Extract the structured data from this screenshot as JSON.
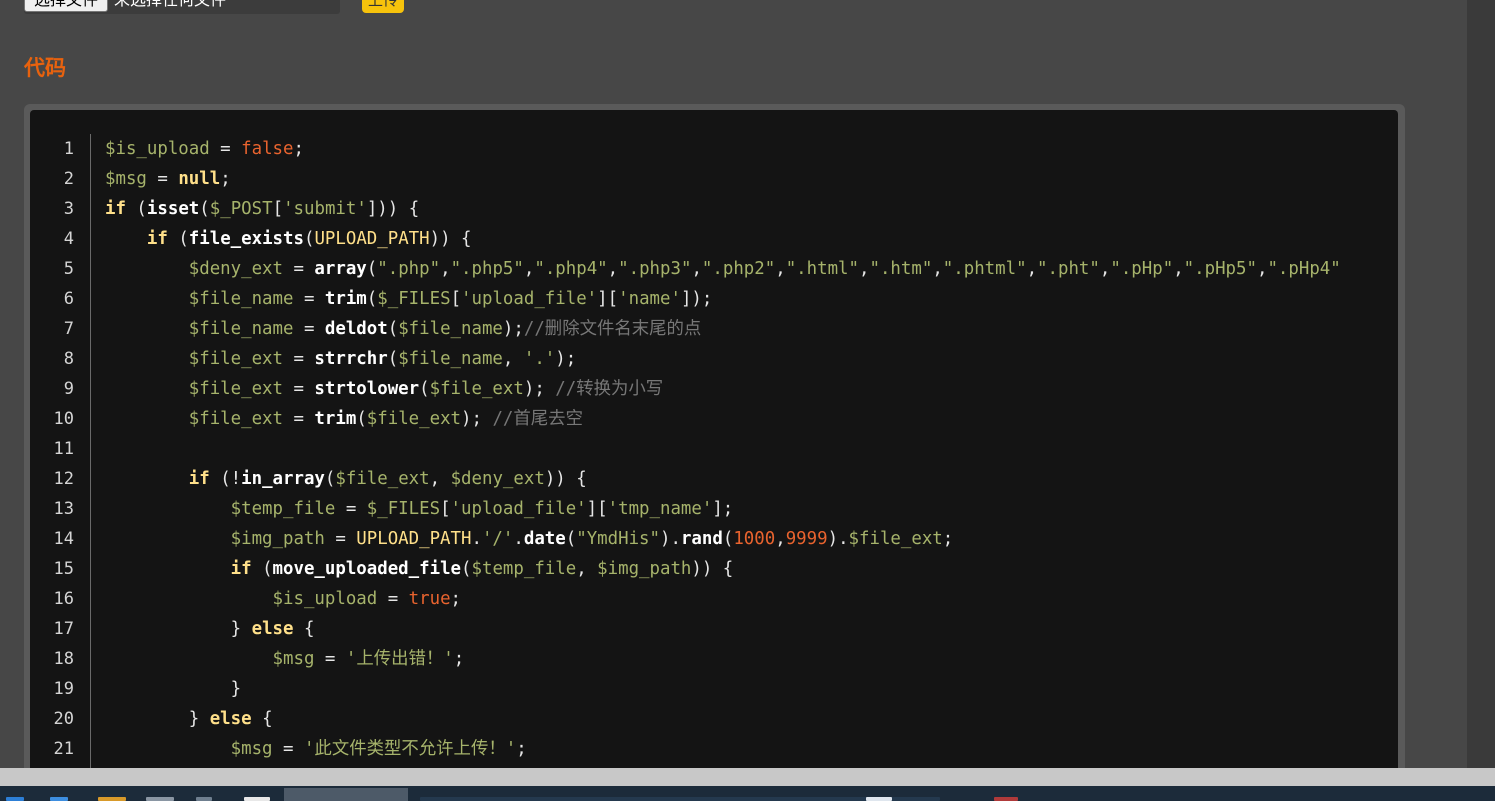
{
  "upload_form": {
    "file_button_label": "选择文件",
    "file_status": "未选择任何文件",
    "upload_button_label": "上传"
  },
  "section": {
    "title": "代码"
  },
  "code": {
    "line_numbers": [
      "1",
      "2",
      "3",
      "4",
      "5",
      "6",
      "7",
      "8",
      "9",
      "10",
      "11",
      "12",
      "13",
      "14",
      "15",
      "16",
      "17",
      "18",
      "19",
      "20",
      "21"
    ],
    "lines": [
      [
        [
          "var",
          "$is_upload"
        ],
        [
          "pn",
          " = "
        ],
        [
          "bool",
          "false"
        ],
        [
          "pn",
          ";"
        ]
      ],
      [
        [
          "var",
          "$msg"
        ],
        [
          "pn",
          " = "
        ],
        [
          "kw",
          "null"
        ],
        [
          "pn",
          ";"
        ]
      ],
      [
        [
          "kw",
          "if"
        ],
        [
          "pn",
          " ("
        ],
        [
          "fn",
          "isset"
        ],
        [
          "pn",
          "("
        ],
        [
          "var",
          "$_POST"
        ],
        [
          "pn",
          "["
        ],
        [
          "str",
          "'submit'"
        ],
        [
          "pn",
          "])) {"
        ]
      ],
      [
        [
          "pn",
          "    "
        ],
        [
          "kw",
          "if"
        ],
        [
          "pn",
          " ("
        ],
        [
          "fn",
          "file_exists"
        ],
        [
          "pn",
          "("
        ],
        [
          "const",
          "UPLOAD_PATH"
        ],
        [
          "pn",
          ")) {"
        ]
      ],
      [
        [
          "pn",
          "        "
        ],
        [
          "var",
          "$deny_ext"
        ],
        [
          "pn",
          " = "
        ],
        [
          "fn",
          "array"
        ],
        [
          "pn",
          "("
        ],
        [
          "str",
          "\".php\""
        ],
        [
          "pn",
          ","
        ],
        [
          "str",
          "\".php5\""
        ],
        [
          "pn",
          ","
        ],
        [
          "str",
          "\".php4\""
        ],
        [
          "pn",
          ","
        ],
        [
          "str",
          "\".php3\""
        ],
        [
          "pn",
          ","
        ],
        [
          "str",
          "\".php2\""
        ],
        [
          "pn",
          ","
        ],
        [
          "str",
          "\".html\""
        ],
        [
          "pn",
          ","
        ],
        [
          "str",
          "\".htm\""
        ],
        [
          "pn",
          ","
        ],
        [
          "str",
          "\".phtml\""
        ],
        [
          "pn",
          ","
        ],
        [
          "str",
          "\".pht\""
        ],
        [
          "pn",
          ","
        ],
        [
          "str",
          "\".pHp\""
        ],
        [
          "pn",
          ","
        ],
        [
          "str",
          "\".pHp5\""
        ],
        [
          "pn",
          ","
        ],
        [
          "str",
          "\".pHp4\""
        ]
      ],
      [
        [
          "pn",
          "        "
        ],
        [
          "var",
          "$file_name"
        ],
        [
          "pn",
          " = "
        ],
        [
          "fn",
          "trim"
        ],
        [
          "pn",
          "("
        ],
        [
          "var",
          "$_FILES"
        ],
        [
          "pn",
          "["
        ],
        [
          "str",
          "'upload_file'"
        ],
        [
          "pn",
          "]["
        ],
        [
          "str",
          "'name'"
        ],
        [
          "pn",
          "]);"
        ]
      ],
      [
        [
          "pn",
          "        "
        ],
        [
          "var",
          "$file_name"
        ],
        [
          "pn",
          " = "
        ],
        [
          "fn",
          "deldot"
        ],
        [
          "pn",
          "("
        ],
        [
          "var",
          "$file_name"
        ],
        [
          "pn",
          ");"
        ],
        [
          "cmt",
          "//删除文件名末尾的点"
        ]
      ],
      [
        [
          "pn",
          "        "
        ],
        [
          "var",
          "$file_ext"
        ],
        [
          "pn",
          " = "
        ],
        [
          "fn",
          "strrchr"
        ],
        [
          "pn",
          "("
        ],
        [
          "var",
          "$file_name"
        ],
        [
          "pn",
          ", "
        ],
        [
          "str",
          "'.'"
        ],
        [
          "pn",
          ");"
        ]
      ],
      [
        [
          "pn",
          "        "
        ],
        [
          "var",
          "$file_ext"
        ],
        [
          "pn",
          " = "
        ],
        [
          "fn",
          "strtolower"
        ],
        [
          "pn",
          "("
        ],
        [
          "var",
          "$file_ext"
        ],
        [
          "pn",
          "); "
        ],
        [
          "cmt",
          "//转换为小写"
        ]
      ],
      [
        [
          "pn",
          "        "
        ],
        [
          "var",
          "$file_ext"
        ],
        [
          "pn",
          " = "
        ],
        [
          "fn",
          "trim"
        ],
        [
          "pn",
          "("
        ],
        [
          "var",
          "$file_ext"
        ],
        [
          "pn",
          "); "
        ],
        [
          "cmt",
          "//首尾去空"
        ]
      ],
      [],
      [
        [
          "pn",
          "        "
        ],
        [
          "kw",
          "if"
        ],
        [
          "pn",
          " (!"
        ],
        [
          "fn",
          "in_array"
        ],
        [
          "pn",
          "("
        ],
        [
          "var",
          "$file_ext"
        ],
        [
          "pn",
          ", "
        ],
        [
          "var",
          "$deny_ext"
        ],
        [
          "pn",
          ")) {"
        ]
      ],
      [
        [
          "pn",
          "            "
        ],
        [
          "var",
          "$temp_file"
        ],
        [
          "pn",
          " = "
        ],
        [
          "var",
          "$_FILES"
        ],
        [
          "pn",
          "["
        ],
        [
          "str",
          "'upload_file'"
        ],
        [
          "pn",
          "]["
        ],
        [
          "str",
          "'tmp_name'"
        ],
        [
          "pn",
          "];"
        ]
      ],
      [
        [
          "pn",
          "            "
        ],
        [
          "var",
          "$img_path"
        ],
        [
          "pn",
          " = "
        ],
        [
          "const",
          "UPLOAD_PATH"
        ],
        [
          "pn",
          "."
        ],
        [
          "str",
          "'/'"
        ],
        [
          "pn",
          "."
        ],
        [
          "fn",
          "date"
        ],
        [
          "pn",
          "("
        ],
        [
          "str",
          "\"YmdHis\""
        ],
        [
          "pn",
          ")."
        ],
        [
          "fn",
          "rand"
        ],
        [
          "pn",
          "("
        ],
        [
          "num",
          "1000"
        ],
        [
          "pn",
          ","
        ],
        [
          "num",
          "9999"
        ],
        [
          "pn",
          ")."
        ],
        [
          "var",
          "$file_ext"
        ],
        [
          "pn",
          ";"
        ]
      ],
      [
        [
          "pn",
          "            "
        ],
        [
          "kw",
          "if"
        ],
        [
          "pn",
          " ("
        ],
        [
          "fn",
          "move_uploaded_file"
        ],
        [
          "pn",
          "("
        ],
        [
          "var",
          "$temp_file"
        ],
        [
          "pn",
          ", "
        ],
        [
          "var",
          "$img_path"
        ],
        [
          "pn",
          ")) {"
        ]
      ],
      [
        [
          "pn",
          "                "
        ],
        [
          "var",
          "$is_upload"
        ],
        [
          "pn",
          " = "
        ],
        [
          "bool",
          "true"
        ],
        [
          "pn",
          ";"
        ]
      ],
      [
        [
          "pn",
          "            } "
        ],
        [
          "kw",
          "else"
        ],
        [
          "pn",
          " {"
        ]
      ],
      [
        [
          "pn",
          "                "
        ],
        [
          "var",
          "$msg"
        ],
        [
          "pn",
          " = "
        ],
        [
          "str",
          "'上传出错！'"
        ],
        [
          "pn",
          ";"
        ]
      ],
      [
        [
          "pn",
          "            }"
        ]
      ],
      [
        [
          "pn",
          "        } "
        ],
        [
          "kw",
          "else"
        ],
        [
          "pn",
          " {"
        ]
      ],
      [
        [
          "pn",
          "            "
        ],
        [
          "var",
          "$msg"
        ],
        [
          "pn",
          " = "
        ],
        [
          "str",
          "'此文件类型不允许上传！'"
        ],
        [
          "pn",
          ";"
        ]
      ]
    ]
  },
  "colors": {
    "section_title": "#e8620e",
    "upload_button": "#f7c30c",
    "code_background": "#141414"
  }
}
